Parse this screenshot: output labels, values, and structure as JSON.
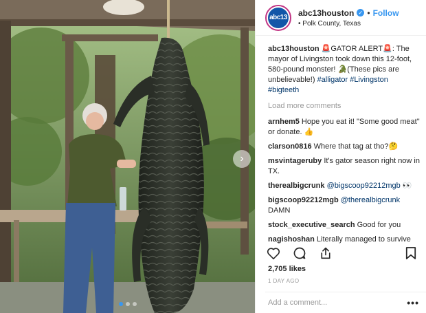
{
  "post": {
    "username": "abc13houston",
    "avatar_text": "abc13",
    "verified_icon": "verified-badge-icon",
    "separator": "•",
    "follow_label": "Follow",
    "location_prefix": "•",
    "location": "Polk County, Texas"
  },
  "caption": {
    "author": "abc13houston",
    "text_1": "🚨GATOR ALERT🚨: The mayor of Livingston took down this 12-foot, 580-pound monster! 🐊(These pics are unbelievable!)",
    "tags": [
      "#alligator",
      "#Livingston",
      "#bigteeth"
    ]
  },
  "load_more_label": "Load more comments",
  "comments": [
    {
      "user": "arnhem5",
      "text": "Hope you eat it! \"Some good meat\" or donate. 👍"
    },
    {
      "user": "clarson0816",
      "text": "Where that tag at tho?🤔"
    },
    {
      "user": "msvintageruby",
      "text": "It's gator season right now in TX."
    },
    {
      "user": "therealbigcrunk",
      "text": "",
      "mention": "@bigscoop92212mgb",
      "suffix": " 👀"
    },
    {
      "user": "bigscoop92212mgb",
      "text": "",
      "mention": "@therealbigcrunk",
      "line2": "DAMN"
    },
    {
      "user": "stock_executive_search",
      "text": "Good for you"
    },
    {
      "user": "nagishoshan",
      "text": "Literally managed to survive for tens of millions of years as a species and"
    }
  ],
  "likes": "2,705 likes",
  "time_ago": "1 DAY AGO",
  "add_comment_placeholder": "Add a comment...",
  "more_icon": "•••",
  "colors": {
    "accent": "#3897f0",
    "text": "#262626",
    "muted": "#999999",
    "hashtag": "#003569"
  },
  "photo": {
    "carousel_next": "›"
  }
}
